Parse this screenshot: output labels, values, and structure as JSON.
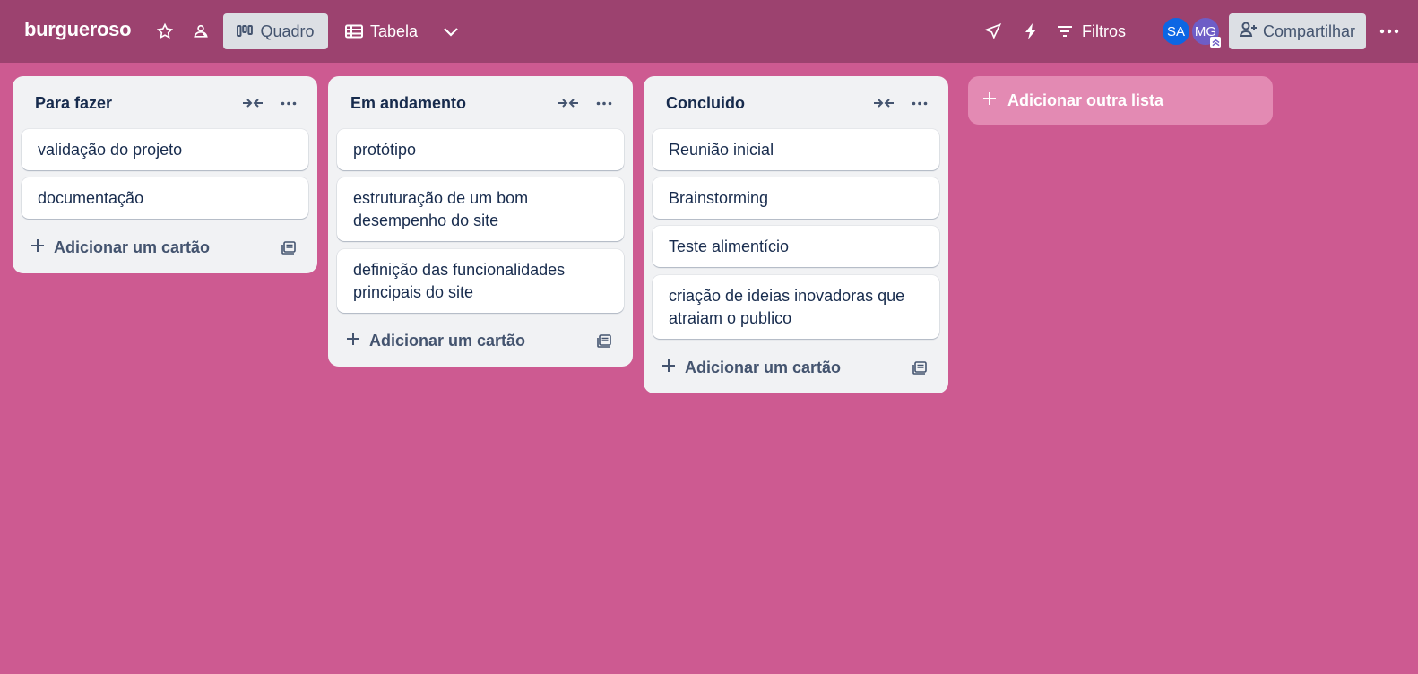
{
  "header": {
    "board_title": "burgueroso",
    "views": [
      {
        "label": "Quadro",
        "active": true
      },
      {
        "label": "Tabela",
        "active": false
      }
    ],
    "filters_label": "Filtros",
    "share_label": "Compartilhar",
    "members": [
      {
        "initials": "SA",
        "color": "#0c66e4"
      },
      {
        "initials": "MG",
        "color": "#6e5dc6"
      }
    ],
    "icons": [
      "star-icon",
      "workspace-visibility-icon",
      "board-view-icon",
      "table-view-icon",
      "chevron-down-icon",
      "power-ups-icon",
      "automation-icon",
      "filter-icon",
      "add-member-icon",
      "more-icon"
    ]
  },
  "lists": [
    {
      "title": "Para fazer",
      "cards": [
        "validação do projeto",
        "documentação"
      ],
      "add_card_label": "Adicionar um cartão"
    },
    {
      "title": "Em andamento",
      "cards": [
        "protótipo",
        "estruturação de um bom desempenho do site",
        "definição das funcionalidades principais do site"
      ],
      "add_card_label": "Adicionar um cartão"
    },
    {
      "title": "Concluido",
      "cards": [
        "Reunião inicial",
        "Brainstorming",
        "Teste alimentício",
        "criação de ideias inovadoras que atraiam o publico"
      ],
      "add_card_label": "Adicionar um cartão"
    }
  ],
  "add_list_label": "Adicionar outra lista",
  "colors": {
    "board_background": "#cd5a91",
    "header_background": "#9c426f",
    "list_background": "#f1f2f4"
  }
}
